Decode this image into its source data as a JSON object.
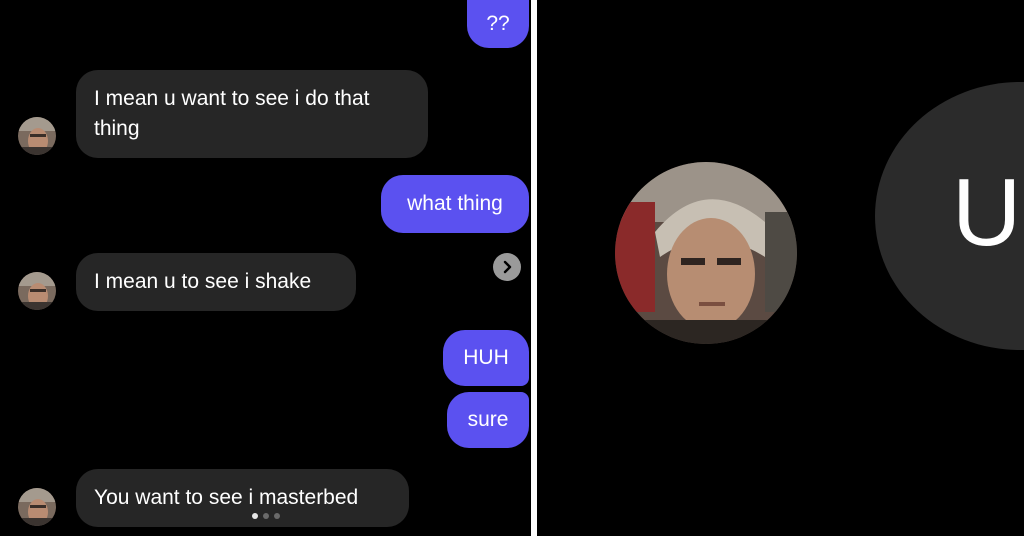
{
  "conversation": {
    "messages": [
      {
        "from": "me",
        "text": "??"
      },
      {
        "from": "them",
        "text": "I mean u want to see i do that thing"
      },
      {
        "from": "me",
        "text": "what thing"
      },
      {
        "from": "them",
        "text": "I mean  u to see i shake"
      },
      {
        "from": "me",
        "text": "HUH"
      },
      {
        "from": "me",
        "text": "sure"
      },
      {
        "from": "them",
        "text": "You want to see i masterbed"
      }
    ],
    "carousel": {
      "pages": 3,
      "current": 1
    }
  },
  "profile": {
    "initial": "U"
  },
  "colors": {
    "outgoing_bubble": "#5b51f0",
    "incoming_bubble": "#262626",
    "background": "#000000"
  },
  "icons": {
    "next": "chevron-right-icon"
  }
}
